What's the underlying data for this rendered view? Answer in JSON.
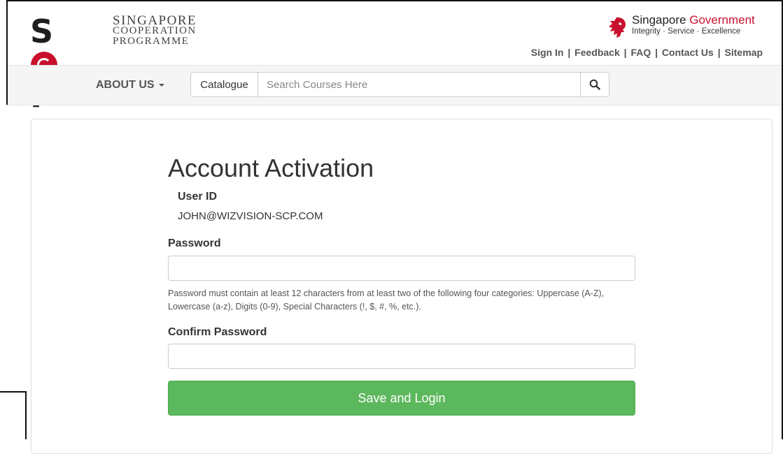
{
  "header": {
    "logo": {
      "mark": "SCP",
      "line1": "SINGAPORE",
      "line2": "COOPERATION",
      "line3": "PROGRAMME"
    },
    "gov": {
      "name_prefix": "Singapore ",
      "name_highlight": "Government",
      "tagline": "Integrity · Service · Excellence",
      "icon": "lion-head-icon",
      "accent_color": "#c8102e"
    },
    "links": [
      "Sign In",
      "Feedback",
      "FAQ",
      "Contact Us",
      "Sitemap"
    ]
  },
  "nav": {
    "about_label": "ABOUT US",
    "catalogue_label": "Catalogue",
    "search_placeholder": "Search Courses Here",
    "search_icon": "search-icon"
  },
  "form": {
    "title": "Account Activation",
    "userid_label": "User ID",
    "userid_value": "JOHN@WIZVISION-SCP.COM",
    "password_label": "Password",
    "password_value": "",
    "password_help": "Password must contain at least 12 characters from at least two of the following four categories: Uppercase (A-Z), Lowercase (a-z), Digits (0-9), Special Characters (!, $, #, %, etc.).",
    "confirm_label": "Confirm Password",
    "confirm_value": "",
    "submit_label": "Save and Login",
    "submit_color": "#5cb85c"
  }
}
